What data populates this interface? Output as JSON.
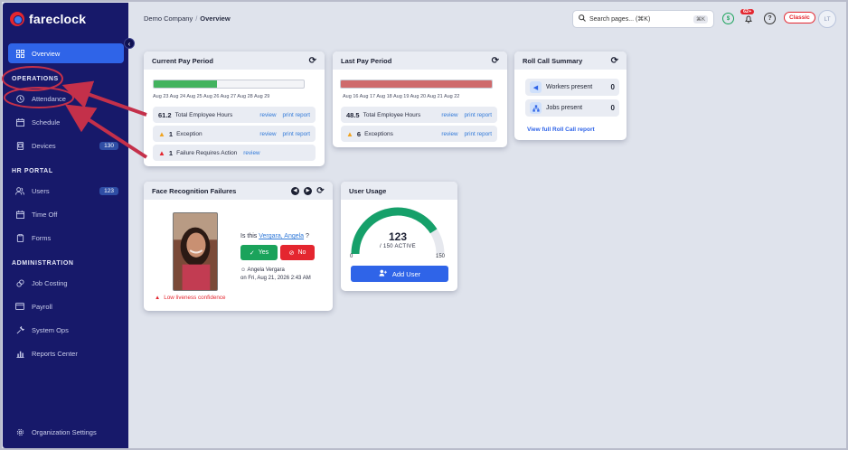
{
  "brand": {
    "name": "fareclock"
  },
  "sidebar": {
    "overview": {
      "label": "Overview"
    },
    "sections": {
      "operations": "OPERATIONS",
      "hr_portal": "HR PORTAL",
      "administration": "ADMINISTRATION"
    },
    "items": [
      {
        "label": "Attendance"
      },
      {
        "label": "Schedule"
      },
      {
        "label": "Devices",
        "badge": "130"
      },
      {
        "label": "Users",
        "badge": "123"
      },
      {
        "label": "Time Off"
      },
      {
        "label": "Forms"
      },
      {
        "label": "Job Costing"
      },
      {
        "label": "Payroll"
      },
      {
        "label": "System Ops"
      },
      {
        "label": "Reports Center"
      },
      {
        "label": "Organization Settings"
      }
    ]
  },
  "header": {
    "company": "Demo Company",
    "separator": "/",
    "page": "Overview",
    "search_placeholder": "Search pages... (⌘K)",
    "search_kbd": "⌘K",
    "notif_count": "62+",
    "classic_label": "Classic",
    "avatar_initials": "LT"
  },
  "current_pay_period": {
    "title": "Current Pay Period",
    "progress": 0.42,
    "dates": "Aug 23 Aug 24 Aug 25 Aug 26 Aug 27 Aug 28 Aug 29",
    "hours_value": "61.2",
    "hours_label": "Total Employee Hours",
    "review": "review",
    "print": "print report",
    "exceptions_value": "1",
    "exceptions_label": "Exception",
    "failures_value": "1",
    "failures_label": "Failure Requires Action"
  },
  "last_pay_period": {
    "title": "Last Pay Period",
    "progress": 1.0,
    "dates": "Aug 16 Aug 17 Aug 18 Aug 19 Aug 20 Aug 21 Aug 22",
    "hours_value": "48.5",
    "hours_label": "Total Employee Hours",
    "review": "review",
    "print": "print report",
    "exceptions_value": "6",
    "exceptions_label": "Exceptions"
  },
  "roll_call": {
    "title": "Roll Call Summary",
    "workers_label": "Workers present",
    "workers_value": "0",
    "jobs_label": "Jobs present",
    "jobs_value": "0",
    "link": "View full Roll Call report"
  },
  "face_recognition": {
    "title": "Face Recognition Failures",
    "question_prefix": "Is this",
    "name": "Vergara, Angela",
    "question_suffix": "?",
    "yes": "Yes",
    "no": "No",
    "meta_name": "Angela Vergara",
    "meta_date": "on Fri, Aug 21, 2026 2:43 AM",
    "warning": "Low liveness confidence"
  },
  "user_usage": {
    "title": "User Usage",
    "value": "123",
    "sub": "/ 150 ACTIVE",
    "fraction": 0.82,
    "min": "0",
    "max": "150",
    "button": "Add User"
  },
  "colors": {
    "sidebar": "#17196a",
    "accent": "#2f64e8",
    "green": "#1aa35b",
    "red": "#e4262f",
    "annotation": "#c4304a"
  },
  "icons": {
    "overview": "grid-icon",
    "attendance": "clock-icon",
    "schedule": "calendar-icon",
    "devices": "device-icon",
    "users": "users-icon",
    "time_off": "calendar-icon",
    "forms": "clipboard-icon",
    "job_costing": "tag-icon",
    "payroll": "card-icon",
    "system_ops": "wrench-icon",
    "reports": "bar-chart-icon",
    "settings": "gear-icon"
  }
}
